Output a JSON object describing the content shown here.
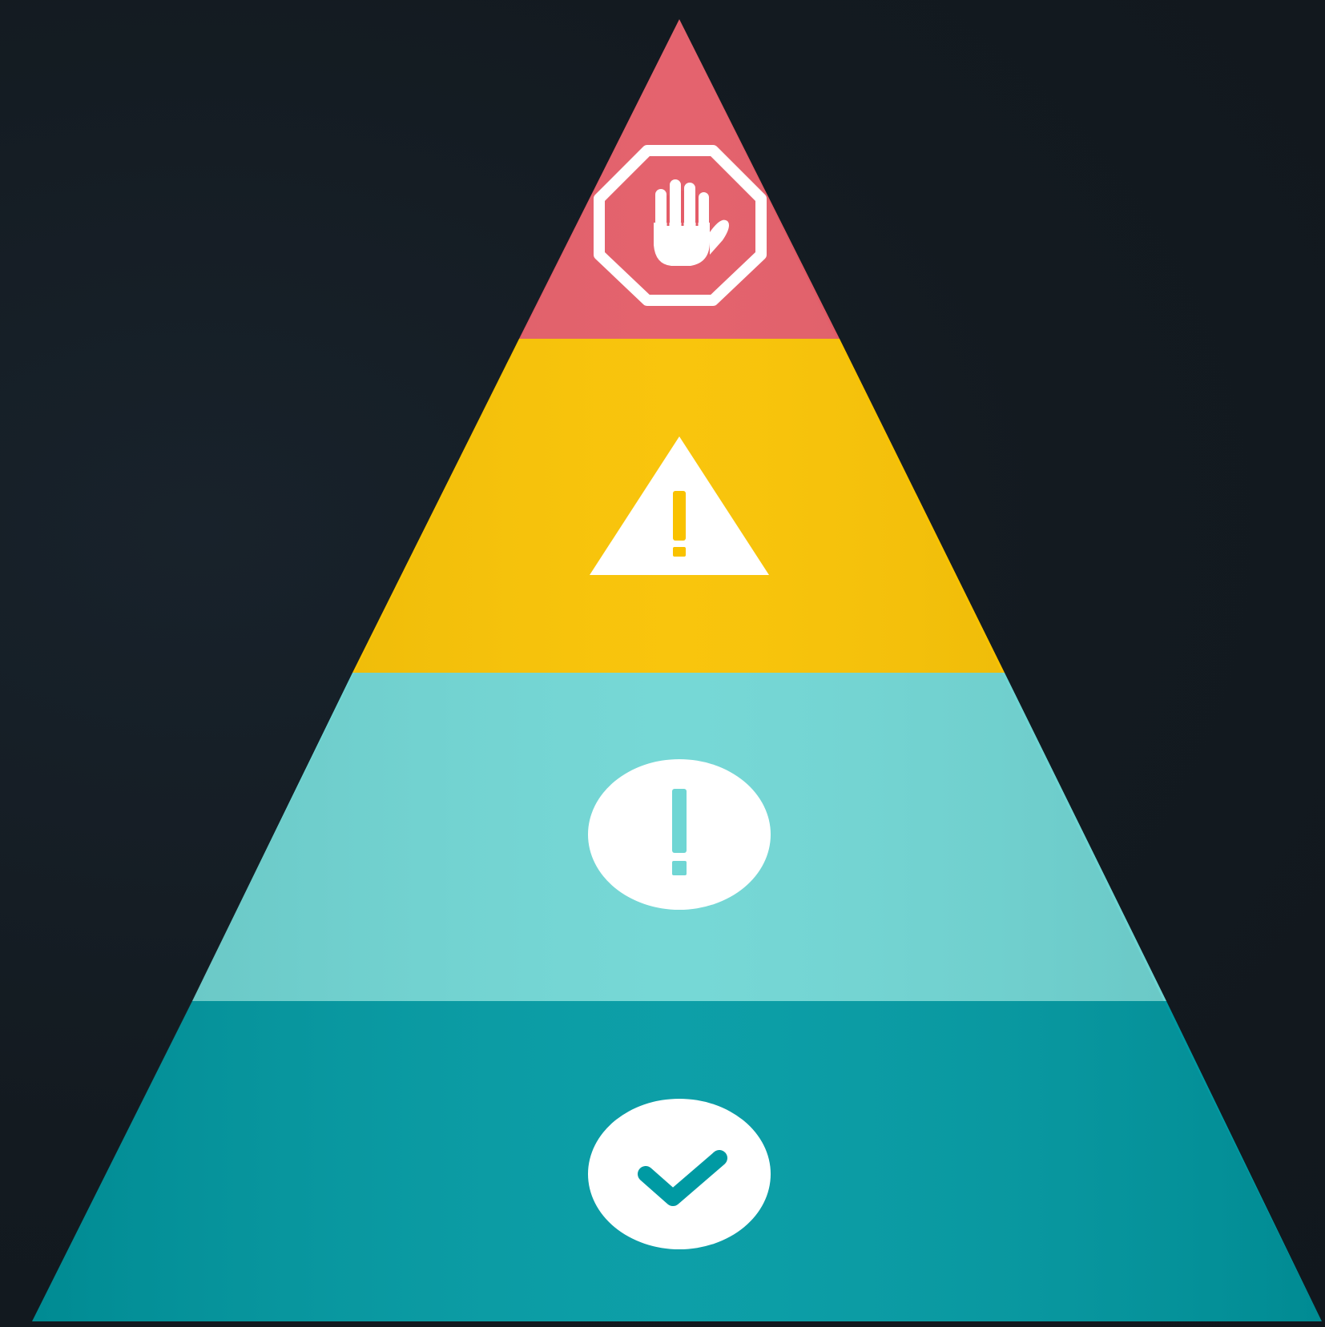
{
  "background_color": "#131a20",
  "tiers": [
    {
      "level": 1,
      "color": "#e35b66",
      "icon": "stop-hand-icon"
    },
    {
      "level": 2,
      "color": "#f9c200",
      "icon": "warning-triangle-icon"
    },
    {
      "level": 3,
      "color": "#6fd6d4",
      "icon": "info-exclamation-circle-icon"
    },
    {
      "level": 4,
      "color": "#009aa3",
      "icon": "check-circle-icon"
    }
  ],
  "icon_fill": "#ffffff"
}
